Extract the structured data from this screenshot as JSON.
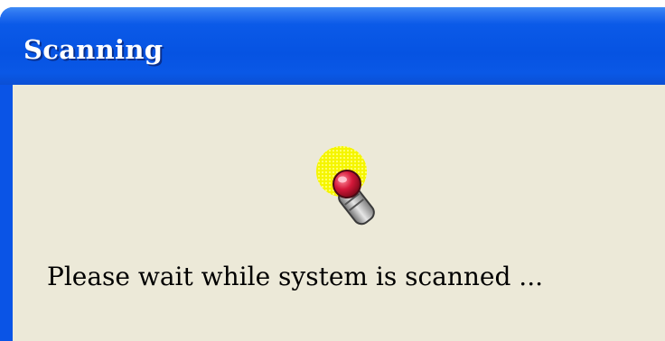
{
  "dialog": {
    "title": "Scanning",
    "message": "Please wait while system is scanned ...",
    "icon": "flashlight-icon"
  },
  "colors": {
    "titlebar_blue": "#0653e2",
    "client_background": "#ece9d8",
    "title_text": "#ffffff"
  }
}
